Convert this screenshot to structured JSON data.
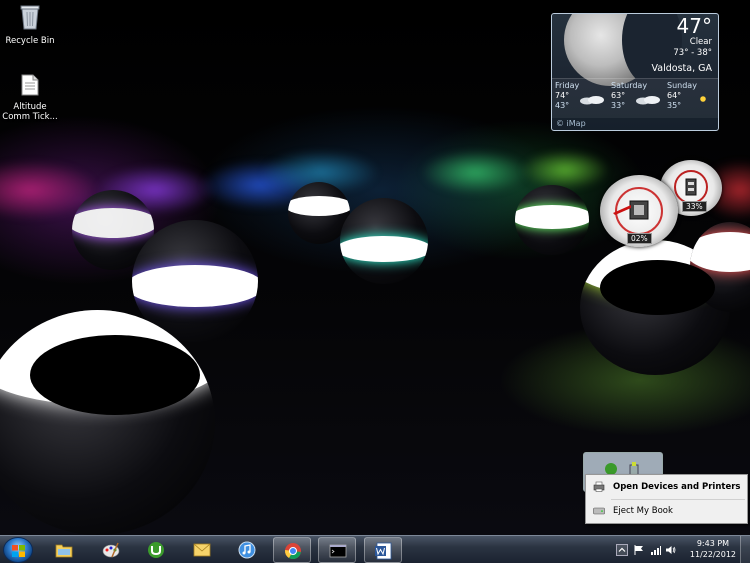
{
  "desktop": {
    "icons": [
      {
        "label": "Recycle Bin",
        "icon": "recycle-bin-icon"
      },
      {
        "label": "Altitude Comm Tick...",
        "icon": "document-icon"
      }
    ]
  },
  "weather": {
    "temperature": "47°",
    "condition": "Clear",
    "range": "73° - 38°",
    "location": "Valdosta, GA",
    "forecast": [
      {
        "day": "Friday",
        "high": "74°",
        "low": "43°",
        "icon": "cloudy-icon"
      },
      {
        "day": "Saturday",
        "high": "63°",
        "low": "33°",
        "icon": "cloudy-icon"
      },
      {
        "day": "Sunday",
        "high": "64°",
        "low": "35°",
        "icon": "sun-icon"
      }
    ],
    "source": "© iMap"
  },
  "meters": {
    "cpu_percent": "02%",
    "memory_percent": "33%"
  },
  "context_menu": {
    "items": [
      {
        "label": "Open Devices and Printers",
        "icon": "printer-icon"
      },
      {
        "label": "Eject My Book",
        "icon": "drive-icon"
      }
    ]
  },
  "taskbar": {
    "start_icon": "windows-start-icon",
    "apps": [
      {
        "name": "explorer",
        "icon": "folder-icon"
      },
      {
        "name": "paint",
        "icon": "paint-icon"
      },
      {
        "name": "utorrent",
        "icon": "utorrent-icon"
      },
      {
        "name": "mail",
        "icon": "mail-icon"
      },
      {
        "name": "itunes",
        "icon": "itunes-icon"
      },
      {
        "name": "chrome",
        "icon": "chrome-icon"
      },
      {
        "name": "command-prompt",
        "icon": "cmd-icon"
      },
      {
        "name": "word",
        "icon": "word-icon"
      }
    ],
    "clock": {
      "time": "9:43 PM",
      "date": "11/22/2012"
    }
  },
  "colors": {
    "taskbar": "#2b3442",
    "menu_bg": "#f0f0f0",
    "accent": "#2c79c9"
  }
}
